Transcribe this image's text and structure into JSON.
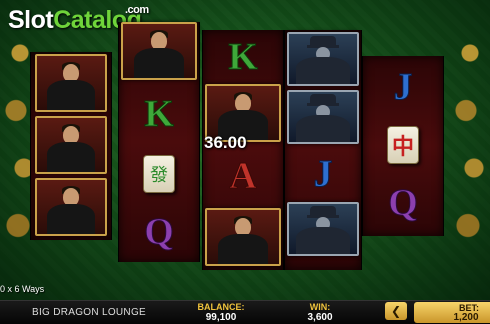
{
  "logo": {
    "part1": "Slot",
    "part2": "Catalog",
    "suffix": ".com"
  },
  "reels": [
    [
      "man",
      "man",
      "man"
    ],
    [
      "man",
      "K",
      "mahjong-green",
      "Q"
    ],
    [
      "K",
      "man",
      "A",
      "man"
    ],
    [
      "detective",
      "detective",
      "J",
      "detective"
    ],
    [
      "J",
      "mahjong-red",
      "Q"
    ]
  ],
  "win_amount": "36.00",
  "ways_text": "0 x 6 Ways",
  "footer": {
    "game_name": "BIG DRAGON LOUNGE",
    "balance_label": "BALANCE:",
    "balance_value": "99,100",
    "win_label": "WIN:",
    "win_value": "3,600",
    "bet_label": "BET:",
    "bet_value": "1,200",
    "bet_decrease_symbol": "❮"
  },
  "symbols": {
    "K": "K",
    "A": "A",
    "Q": "Q",
    "J": "J",
    "mahjong_green": "發",
    "mahjong_red": "中"
  },
  "colors": {
    "accent_gold": "#f0c33c",
    "logo_green": "#6fd43a",
    "reel_red": "#4a0b0c"
  }
}
